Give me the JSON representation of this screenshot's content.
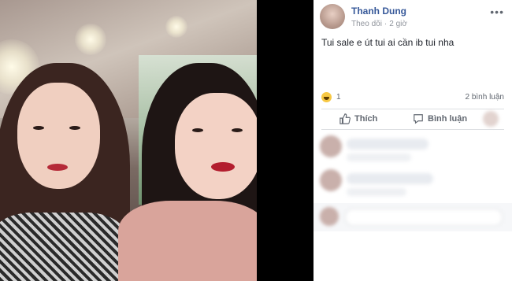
{
  "post": {
    "author": "Thanh Dung",
    "follow": "Theo dõi",
    "time": "2 giờ",
    "more": "•••",
    "text": "Tui sale e út tui ai cần ib tui nha",
    "reaction_count": "1",
    "comment_count": "2 bình luận",
    "actions": {
      "like": "Thích",
      "comment": "Bình luận"
    }
  },
  "colors": {
    "author_link": "#365899",
    "meta": "#90949c",
    "reaction": "#f7c844"
  },
  "icons": {
    "reaction": "haha-icon",
    "like": "thumbs-up-icon",
    "comment": "speech-bubble-icon",
    "more": "more-dots-icon"
  }
}
